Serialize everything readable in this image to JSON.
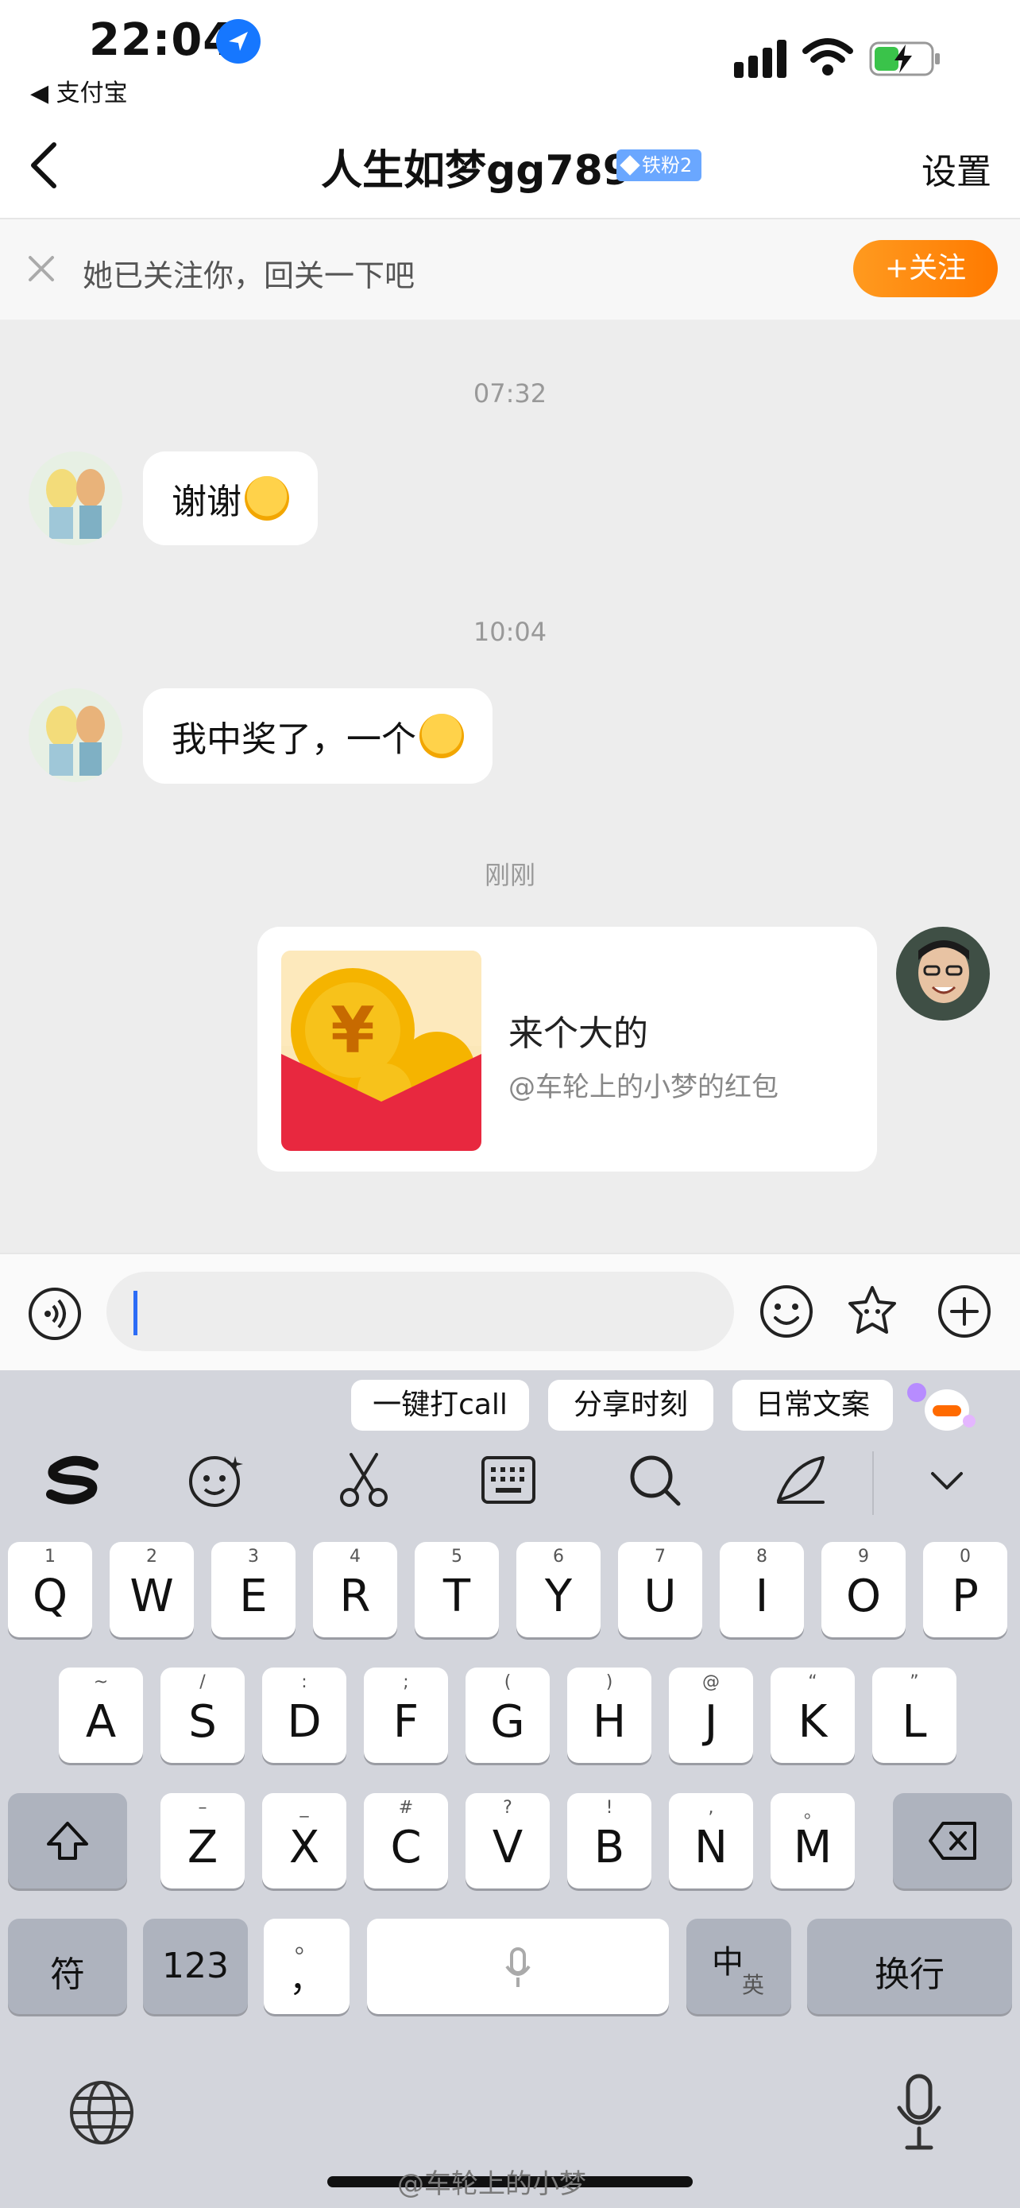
{
  "status_bar": {
    "time": "22:04",
    "back_app": "◀ 支付宝",
    "icons": [
      "location-icon",
      "signal-icon",
      "wifi-icon",
      "battery-charging-icon"
    ]
  },
  "nav": {
    "title": "人生如梦gg789",
    "badge": "铁粉2",
    "settings": "设置"
  },
  "follow_bar": {
    "text": "她已关注你，回关一下吧",
    "button": "+关注"
  },
  "messages": {
    "ts1": "07:32",
    "msg1": "谢谢",
    "ts2": "10:04",
    "msg2": "我中奖了，一个",
    "ts3": "刚刚",
    "card_title": "来个大的",
    "card_sub": "@车轮上的小梦的红包"
  },
  "input": {
    "value": "",
    "placeholder": ""
  },
  "suggestions": [
    "一键打call",
    "分享时刻",
    "日常文案"
  ],
  "keys": {
    "row1": [
      [
        "Q",
        "1"
      ],
      [
        "W",
        "2"
      ],
      [
        "E",
        "3"
      ],
      [
        "R",
        "4"
      ],
      [
        "T",
        "5"
      ],
      [
        "Y",
        "6"
      ],
      [
        "U",
        "7"
      ],
      [
        "I",
        "8"
      ],
      [
        "O",
        "9"
      ],
      [
        "P",
        "0"
      ]
    ],
    "row2": [
      [
        "A",
        "~"
      ],
      [
        "S",
        "/"
      ],
      [
        "D",
        ":"
      ],
      [
        "F",
        ";"
      ],
      [
        "G",
        "("
      ],
      [
        "H",
        ")"
      ],
      [
        "J",
        "@"
      ],
      [
        "K",
        "“"
      ],
      [
        "L",
        "”"
      ]
    ],
    "row3": [
      [
        "Z",
        "–"
      ],
      [
        "X",
        "_"
      ],
      [
        "C",
        "#"
      ],
      [
        "V",
        "?"
      ],
      [
        "B",
        "!"
      ],
      [
        "N",
        ","
      ],
      [
        "M",
        "。"
      ]
    ],
    "sym": "符",
    "num": "123",
    "punct": "，",
    "punct_hint": "。",
    "lang": "中",
    "lang_sub": "英",
    "enter": "换行"
  },
  "watermark": "@车轮上的小梦",
  "colors": {
    "accent": "#ff8a00",
    "badge": "#6aa7ff",
    "caret": "#2c6cf6",
    "red_envelope": "#e8283f"
  }
}
